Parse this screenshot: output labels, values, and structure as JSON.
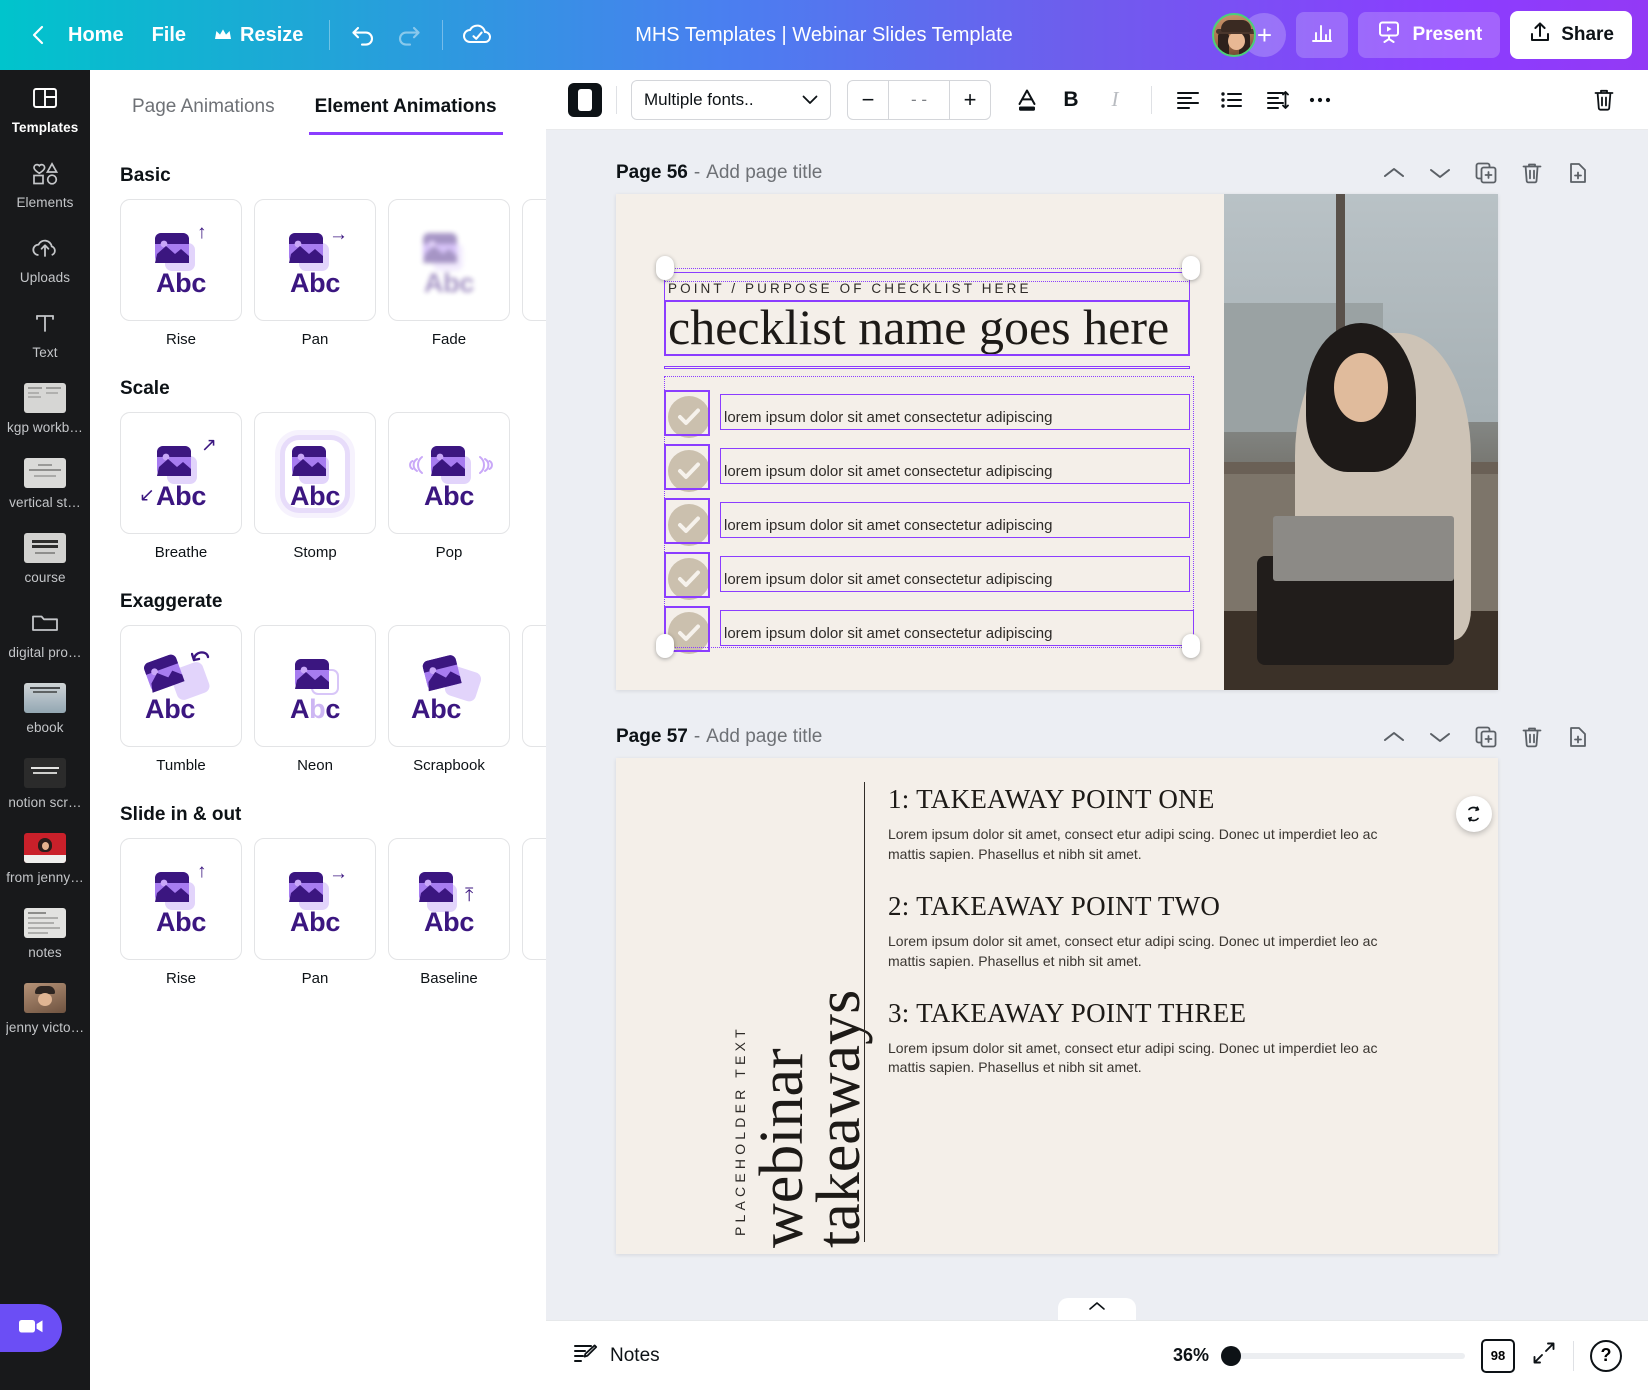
{
  "topbar": {
    "back_icon": "chevron-left-icon",
    "home": "Home",
    "file": "File",
    "resize": "Resize",
    "resize_crown_icon": "crown-icon",
    "undo_icon": "undo-icon",
    "redo_icon": "redo-icon",
    "cloud_icon": "cloud-saved-icon",
    "doc_title": "MHS Templates | Webinar Slides Template",
    "add_collaborator": "+",
    "stats_icon": "bar-chart-icon",
    "present": "Present",
    "present_icon": "present-screen-icon",
    "share": "Share",
    "share_icon": "share-upload-icon"
  },
  "rail": {
    "items": [
      {
        "label": "Templates",
        "icon": "templates-icon",
        "active": true
      },
      {
        "label": "Elements",
        "icon": "elements-shapes-icon",
        "active": false
      },
      {
        "label": "Uploads",
        "icon": "cloud-upload-icon",
        "active": false
      },
      {
        "label": "Text",
        "icon": "text-t-icon",
        "active": false
      },
      {
        "label": "kgp workb…",
        "icon": "thumbnail-icon",
        "active": false
      },
      {
        "label": "vertical st…",
        "icon": "thumbnail-icon",
        "active": false
      },
      {
        "label": "course",
        "icon": "thumbnail-icon",
        "active": false
      },
      {
        "label": "digital pro…",
        "icon": "folder-icon",
        "active": false
      },
      {
        "label": "ebook",
        "icon": "thumbnail-icon",
        "active": false
      },
      {
        "label": "notion scr…",
        "icon": "thumbnail-icon",
        "active": false
      },
      {
        "label": "from jenny…",
        "icon": "thumbnail-icon",
        "active": false
      },
      {
        "label": "notes",
        "icon": "thumbnail-icon",
        "active": false
      },
      {
        "label": "jenny victo…",
        "icon": "thumbnail-icon",
        "active": false
      }
    ],
    "record_button_icon": "video-camera-icon"
  },
  "panel": {
    "tabs": [
      {
        "label": "Page Animations",
        "active": false
      },
      {
        "label": "Element Animations",
        "active": true
      }
    ],
    "sections": [
      {
        "title": "Basic",
        "items": [
          {
            "label": "Rise",
            "art": "up"
          },
          {
            "label": "Pan",
            "art": "right"
          },
          {
            "label": "Fade",
            "art": "fade"
          },
          {
            "label": "",
            "art": "cut"
          }
        ]
      },
      {
        "title": "Scale",
        "items": [
          {
            "label": "Breathe",
            "art": "diag"
          },
          {
            "label": "Stomp",
            "art": "stomp"
          },
          {
            "label": "Pop",
            "art": "pop"
          }
        ]
      },
      {
        "title": "Exaggerate",
        "items": [
          {
            "label": "Tumble",
            "art": "tumble"
          },
          {
            "label": "Neon",
            "art": "neon"
          },
          {
            "label": "Scrapbook",
            "art": "scrapbook"
          },
          {
            "label": "",
            "art": "cut"
          }
        ]
      },
      {
        "title": "Slide in & out",
        "items": [
          {
            "label": "Rise",
            "art": "up"
          },
          {
            "label": "Pan",
            "art": "right"
          },
          {
            "label": "Baseline",
            "art": "baseline"
          },
          {
            "label": "",
            "art": "cut"
          }
        ]
      }
    ]
  },
  "edit_toolbar": {
    "color_swatch_label": "text-color-black",
    "font_name": "Multiple fonts..",
    "font_size_decrease": "−",
    "font_size_value": "- -",
    "font_size_increase": "+",
    "text_color_icon": "text-color-a-icon",
    "bold": "B",
    "italic": "I",
    "align_icon": "align-left-icon",
    "list_icon": "bullet-list-icon",
    "spacing_icon": "line-spacing-icon",
    "more_icon": "more-dots-icon",
    "delete_icon": "trash-icon"
  },
  "pages": [
    {
      "label": "Page 56",
      "separator": "-",
      "title_placeholder": "Add page title",
      "actions": [
        "move-up-icon",
        "move-down-icon",
        "duplicate-page-icon",
        "delete-page-icon",
        "add-page-icon"
      ],
      "slide": {
        "eyebrow": "POINT / PURPOSE OF CHECKLIST HERE",
        "heading": "checklist name goes here",
        "items": [
          "lorem ipsum dolor sit amet consectetur adipiscing",
          "lorem ipsum dolor sit amet consectetur adipiscing",
          "lorem ipsum dolor sit amet consectetur adipiscing",
          "lorem ipsum dolor sit amet consectetur adipiscing",
          "lorem ipsum dolor sit amet consectetur adipiscing"
        ],
        "checkbox_icon": "check-circle-icon",
        "photo_alt": "woman-with-laptop-by-window-photo",
        "rotate_icon": "rotate-handle-icon"
      }
    },
    {
      "label": "Page 57",
      "separator": "-",
      "title_placeholder": "Add page title",
      "actions": [
        "move-up-icon",
        "move-down-icon",
        "duplicate-page-icon",
        "delete-page-icon",
        "add-page-icon"
      ],
      "slide": {
        "vertical_eyebrow": "PLACEHOLDER TEXT",
        "vertical_title": "webinar\ntakeaways",
        "points": [
          {
            "heading": "1: TAKEAWAY POINT ONE",
            "body": "Lorem ipsum dolor sit amet, consect etur adipi scing. Donec ut imperdiet leo ac mattis sapien. Phasellus et nibh sit amet."
          },
          {
            "heading": "2: TAKEAWAY POINT TWO",
            "body": "Lorem ipsum dolor sit amet, consect etur adipi scing. Donec ut imperdiet leo ac mattis sapien. Phasellus et nibh sit amet."
          },
          {
            "heading": "3: TAKEAWAY POINT THREE",
            "body": "Lorem ipsum dolor sit amet, consect etur adipi scing. Donec ut imperdiet leo ac mattis sapien. Phasellus et nibh sit amet."
          }
        ]
      }
    }
  ],
  "bottom_bar": {
    "notes_icon": "notes-pen-icon",
    "notes": "Notes",
    "zoom": "36%",
    "page_count": "98",
    "fullscreen_icon": "expand-icon",
    "help": "?",
    "collapse_icon": "chevron-up-icon"
  },
  "colors": {
    "brand_purple": "#8b3dff",
    "brand_teal": "#00c4cc",
    "slide_bg": "#f4efe9",
    "stage_bg": "#eceef3",
    "rail_bg": "#18191b"
  }
}
